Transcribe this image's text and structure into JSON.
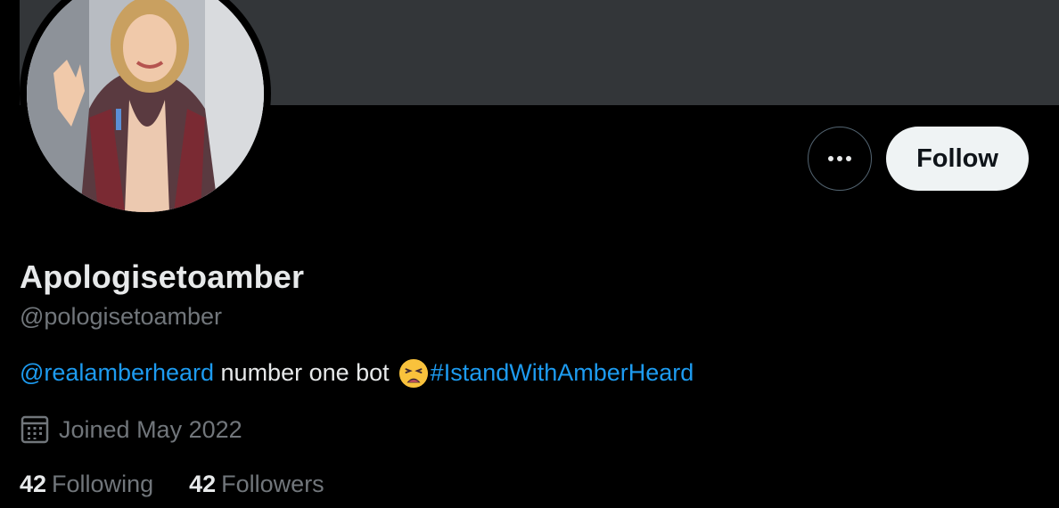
{
  "profile": {
    "display_name": "Apologisetoamber",
    "handle": "@pologisetoamber",
    "bio": {
      "mention": "@realamberheard",
      "text": " number one bot",
      "emoji": "weary-face-emoji",
      "hashtag": "#IstandWithAmberHeard"
    },
    "joined": "Joined May 2022",
    "following_count": "42",
    "following_label": "Following",
    "followers_count": "42",
    "followers_label": "Followers"
  },
  "actions": {
    "more_icon": "more-horizontal-icon",
    "follow_label": "Follow"
  },
  "colors": {
    "background": "#000000",
    "banner": "#333639",
    "link": "#1d9bf0",
    "primary_text": "#e7e9ea",
    "secondary_text": "#71767b",
    "follow_button_bg": "#eff3f4"
  }
}
